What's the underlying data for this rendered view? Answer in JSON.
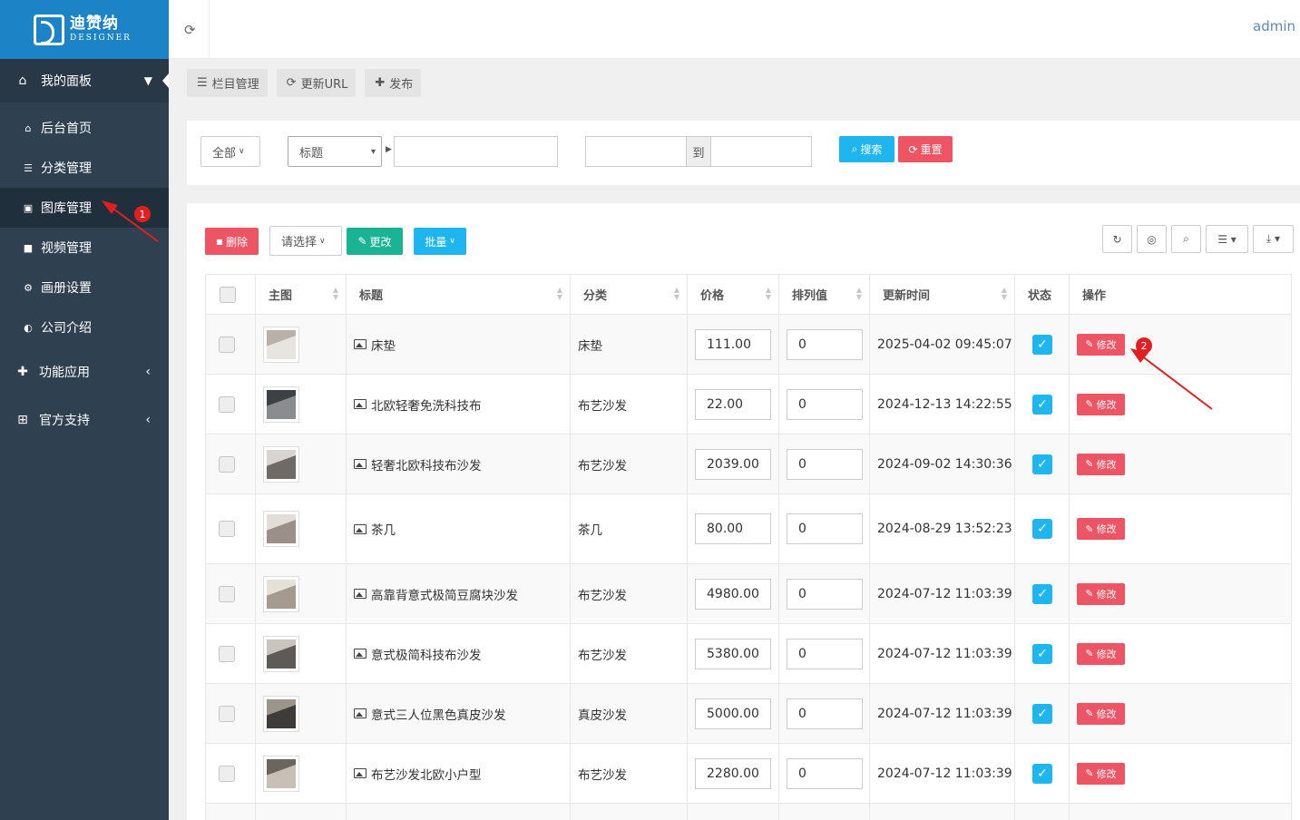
{
  "logo": {
    "cn": "迪赞纳",
    "en": "DESIGNER"
  },
  "user": "admin",
  "sidebar": {
    "panel_label": "我的面板",
    "items": [
      {
        "label": "后台首页",
        "icon": "home-icon"
      },
      {
        "label": "分类管理",
        "icon": "list-icon"
      },
      {
        "label": "图库管理",
        "icon": "image-icon"
      },
      {
        "label": "视频管理",
        "icon": "video-icon"
      },
      {
        "label": "画册设置",
        "icon": "gear-icon"
      },
      {
        "label": "公司介绍",
        "icon": "compass-icon"
      }
    ],
    "groups": [
      {
        "label": "功能应用",
        "icon": "puzzle-icon"
      },
      {
        "label": "官方支持",
        "icon": "gift-icon"
      }
    ]
  },
  "toolbar": {
    "columns": "栏目管理",
    "update_url": "更新URL",
    "publish": "发布"
  },
  "search": {
    "scope": "全部",
    "field": "标题",
    "range_sep": "到",
    "search_label": "搜索",
    "reset_label": "重置"
  },
  "actions": {
    "delete_label": "删除",
    "choose_label": "请选择",
    "change_label": "更改",
    "batch_label": "批量",
    "edit_label": "修改"
  },
  "table": {
    "headers": [
      "主图",
      "标题",
      "分类",
      "价格",
      "排列值",
      "更新时间",
      "状态",
      "操作"
    ],
    "rows": [
      {
        "title": "床垫",
        "category": "床垫",
        "price": "111.00",
        "order": "0",
        "updated": "2025-04-02 09:45:07"
      },
      {
        "title": "北欧轻奢免洗科技布",
        "category": "布艺沙发",
        "price": "22.00",
        "order": "0",
        "updated": "2024-12-13 14:22:55"
      },
      {
        "title": "轻奢北欧科技布沙发",
        "category": "布艺沙发",
        "price": "2039.00",
        "order": "0",
        "updated": "2024-09-02 14:30:36"
      },
      {
        "title": "茶几",
        "category": "茶几",
        "price": "80.00",
        "order": "0",
        "updated": "2024-08-29 13:52:23"
      },
      {
        "title": "高靠背意式极简豆腐块沙发",
        "category": "布艺沙发",
        "price": "4980.00",
        "order": "0",
        "updated": "2024-07-12 11:03:39"
      },
      {
        "title": "意式极简科技布沙发",
        "category": "布艺沙发",
        "price": "5380.00",
        "order": "0",
        "updated": "2024-07-12 11:03:39"
      },
      {
        "title": "意式三人位黑色真皮沙发",
        "category": "真皮沙发",
        "price": "5000.00",
        "order": "0",
        "updated": "2024-07-12 11:03:39"
      },
      {
        "title": "布艺沙发北欧小户型",
        "category": "布艺沙发",
        "price": "2280.00",
        "order": "0",
        "updated": "2024-07-12 11:03:39"
      }
    ]
  },
  "annotations": {
    "badge1": "1",
    "badge2": "2"
  },
  "colors": {
    "sidebar": "#2f4050",
    "brand": "#1c84c6",
    "accent_blue": "#1fb5ee",
    "danger": "#ed5565",
    "success": "#1ab394"
  }
}
